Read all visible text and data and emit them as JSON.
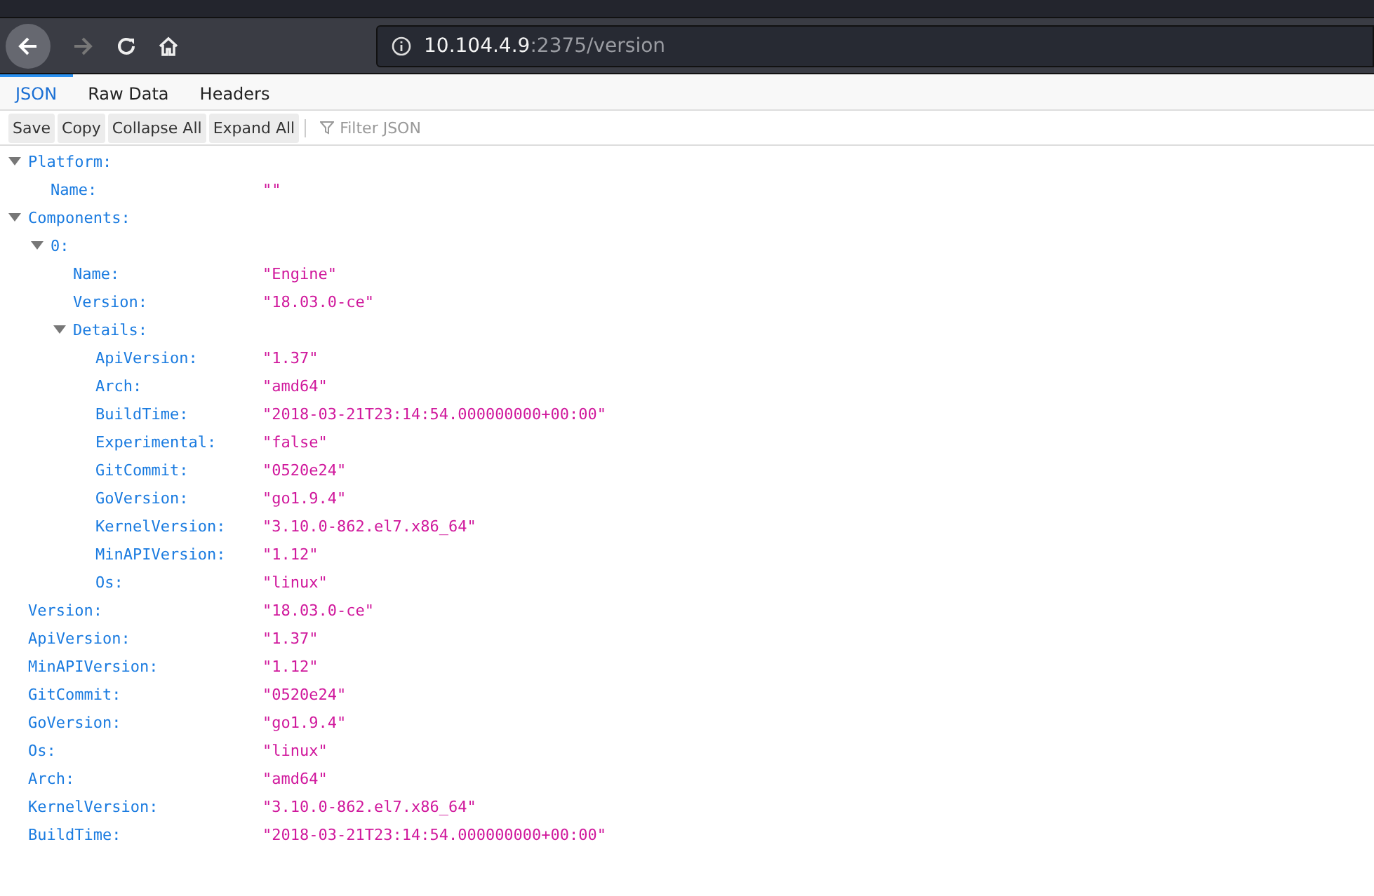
{
  "address_bar": {
    "host": "10.104.4.9",
    "path": ":2375/version"
  },
  "tabs": [
    {
      "label": "JSON",
      "selected": true
    },
    {
      "label": "Raw Data",
      "selected": false
    },
    {
      "label": "Headers",
      "selected": false
    }
  ],
  "toolbar": {
    "buttons": [
      "Save",
      "Copy",
      "Collapse All",
      "Expand All"
    ],
    "filter": {
      "placeholder": "Filter JSON"
    }
  },
  "tree": [
    {
      "key": "Platform:",
      "expanded": true,
      "children": [
        {
          "key": "Name:",
          "value": "\"\""
        }
      ]
    },
    {
      "key": "Components:",
      "expanded": true,
      "children": [
        {
          "key": "0:",
          "expanded": true,
          "children": [
            {
              "key": "Name:",
              "value": "\"Engine\""
            },
            {
              "key": "Version:",
              "value": "\"18.03.0-ce\""
            },
            {
              "key": "Details:",
              "expanded": true,
              "children": [
                {
                  "key": "ApiVersion:",
                  "value": "\"1.37\""
                },
                {
                  "key": "Arch:",
                  "value": "\"amd64\""
                },
                {
                  "key": "BuildTime:",
                  "value": "\"2018-03-21T23:14:54.000000000+00:00\""
                },
                {
                  "key": "Experimental:",
                  "value": "\"false\""
                },
                {
                  "key": "GitCommit:",
                  "value": "\"0520e24\""
                },
                {
                  "key": "GoVersion:",
                  "value": "\"go1.9.4\""
                },
                {
                  "key": "KernelVersion:",
                  "value": "\"3.10.0-862.el7.x86_64\""
                },
                {
                  "key": "MinAPIVersion:",
                  "value": "\"1.12\""
                },
                {
                  "key": "Os:",
                  "value": "\"linux\""
                }
              ]
            }
          ]
        }
      ]
    },
    {
      "key": "Version:",
      "value": "\"18.03.0-ce\""
    },
    {
      "key": "ApiVersion:",
      "value": "\"1.37\""
    },
    {
      "key": "MinAPIVersion:",
      "value": "\"1.12\""
    },
    {
      "key": "GitCommit:",
      "value": "\"0520e24\""
    },
    {
      "key": "GoVersion:",
      "value": "\"go1.9.4\""
    },
    {
      "key": "Os:",
      "value": "\"linux\""
    },
    {
      "key": "Arch:",
      "value": "\"amd64\""
    },
    {
      "key": "KernelVersion:",
      "value": "\"3.10.0-862.el7.x86_64\""
    },
    {
      "key": "BuildTime:",
      "value": "\"2018-03-21T23:14:54.000000000+00:00\""
    }
  ]
}
